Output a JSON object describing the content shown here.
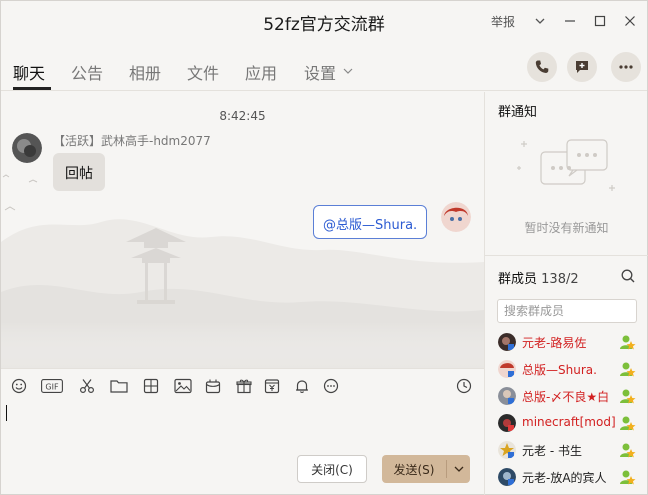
{
  "window": {
    "title": "52fz官方交流群",
    "report_label": "举报"
  },
  "tabs": [
    {
      "label": "聊天"
    },
    {
      "label": "公告"
    },
    {
      "label": "相册"
    },
    {
      "label": "文件"
    },
    {
      "label": "应用"
    },
    {
      "label": "设置"
    }
  ],
  "chat": {
    "timestamp": "8:42:45",
    "messages": [
      {
        "sender": "【活跃】武林高手-hdm2077",
        "text": "回帖",
        "side": "left"
      },
      {
        "text": "@总版—Shura.",
        "side": "right"
      }
    ]
  },
  "composer": {
    "close_label": "关闭(C)",
    "send_label": "发送(S)"
  },
  "sidebar": {
    "notice_title": "群通知",
    "notice_empty": "暂时没有新通知",
    "members_title": "群成员",
    "members_count": "138/2",
    "search_placeholder": "搜索群成员",
    "members": [
      {
        "name": "元老-路易佐",
        "color": "#d22020"
      },
      {
        "name": "总版—Shura.",
        "color": "#d22020"
      },
      {
        "name": "总版-〆不良★白",
        "color": "#d22020"
      },
      {
        "name": "minecraft[mod]",
        "color": "#d22020"
      },
      {
        "name": "元老 - 书生",
        "color": "#222222"
      },
      {
        "name": "元老-放A的宾人",
        "color": "#222222"
      }
    ]
  },
  "colors": {
    "accent_send": "#d2b89a",
    "mention_blue": "#2c5bd2",
    "member_red": "#d22020"
  }
}
